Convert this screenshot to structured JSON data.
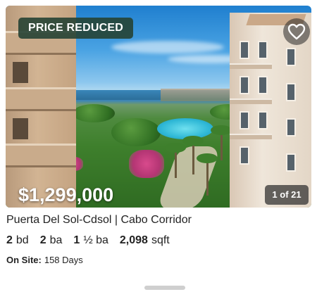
{
  "listing": {
    "badge": "PRICE REDUCED",
    "favorite_icon": "heart-icon",
    "price": "$1,299,000",
    "photo_counter": "1 of 21",
    "address": "Puerta Del Sol-Cdsol | Cabo Corridor",
    "beds_value": "2",
    "beds_unit": "bd",
    "baths_full_value": "2",
    "baths_full_unit": "ba",
    "baths_half_value": "1",
    "baths_half_unit": "½ ba",
    "sqft_value": "2,098",
    "sqft_unit": "sqft",
    "onsite_label": "On Site:",
    "onsite_value": "158 Days"
  },
  "colors": {
    "badge_bg": "#264234",
    "text": "#222222"
  }
}
